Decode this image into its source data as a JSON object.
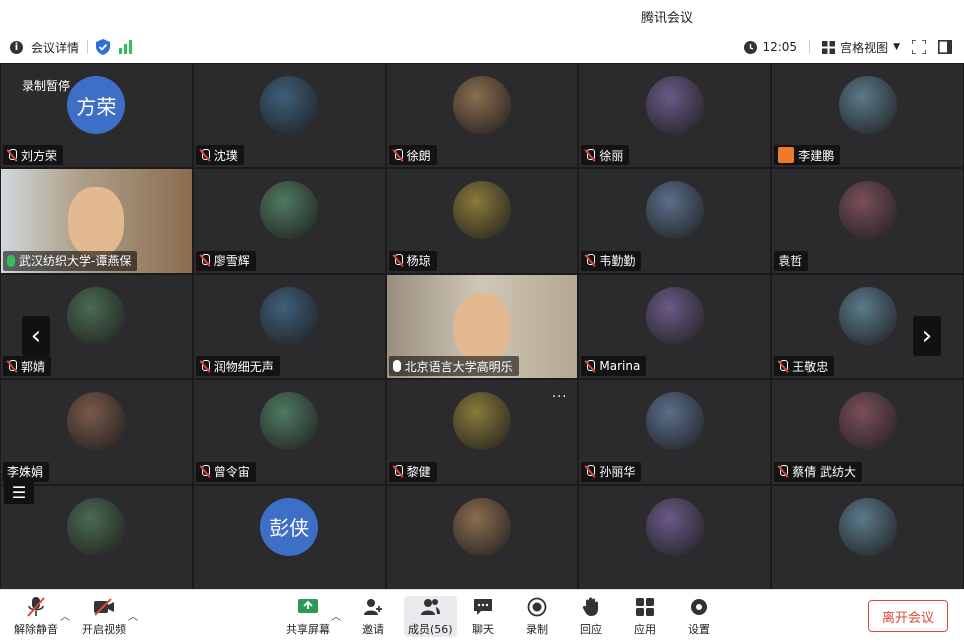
{
  "window": {
    "title": "腾讯会议"
  },
  "infobar": {
    "meeting_details_label": "会议详情",
    "time": "12:05",
    "view_mode_label": "宫格视图"
  },
  "grid": {
    "recording_label": "录制暂停",
    "tiles": [
      {
        "name": "刘方荣",
        "avatar_text": "方荣",
        "mic": "muted"
      },
      {
        "name": "沈璞",
        "mic": "muted"
      },
      {
        "name": "徐朗",
        "mic": "muted"
      },
      {
        "name": "徐丽",
        "mic": "muted"
      },
      {
        "name": "李建鹏",
        "mic": "user"
      },
      {
        "name": "武汉纺织大学-谭燕保",
        "mic": "on",
        "video": true
      },
      {
        "name": "廖雪辉",
        "mic": "muted"
      },
      {
        "name": "杨琼",
        "mic": "muted"
      },
      {
        "name": "韦勤勤",
        "mic": "muted"
      },
      {
        "name": "袁哲",
        "mic": "none"
      },
      {
        "name": "郭婧",
        "mic": "muted"
      },
      {
        "name": "润物细无声",
        "mic": "muted"
      },
      {
        "name": "北京语言大学高明乐",
        "mic": "on-white",
        "video": true
      },
      {
        "name": "Marina",
        "mic": "muted"
      },
      {
        "name": "王敬忠",
        "mic": "muted"
      },
      {
        "name": "李姝娟",
        "mic": "none"
      },
      {
        "name": "曾令宙",
        "mic": "muted"
      },
      {
        "name": "黎健",
        "mic": "muted"
      },
      {
        "name": "孙丽华",
        "mic": "muted"
      },
      {
        "name": "蔡倩 武纺大",
        "mic": "muted"
      },
      {
        "name": "",
        "mic": "none"
      },
      {
        "name": "",
        "avatar_text": "彭侠",
        "mic": "none"
      },
      {
        "name": "",
        "mic": "none"
      },
      {
        "name": "",
        "mic": "none"
      },
      {
        "name": "",
        "mic": "none"
      }
    ]
  },
  "toolbar": {
    "unmute_label": "解除静音",
    "start_video_label": "开启视频",
    "share_screen_label": "共享屏幕",
    "invite_label": "邀请",
    "members_label": "成员(56)",
    "chat_label": "聊天",
    "record_label": "录制",
    "reactions_label": "回应",
    "apps_label": "应用",
    "settings_label": "设置",
    "leave_label": "离开会议"
  },
  "colors": {
    "accent": "#3d6fc6",
    "active_speaker": "#2fbf5b",
    "leave": "#e0453a",
    "grid_bg": "#2b2b2e"
  }
}
